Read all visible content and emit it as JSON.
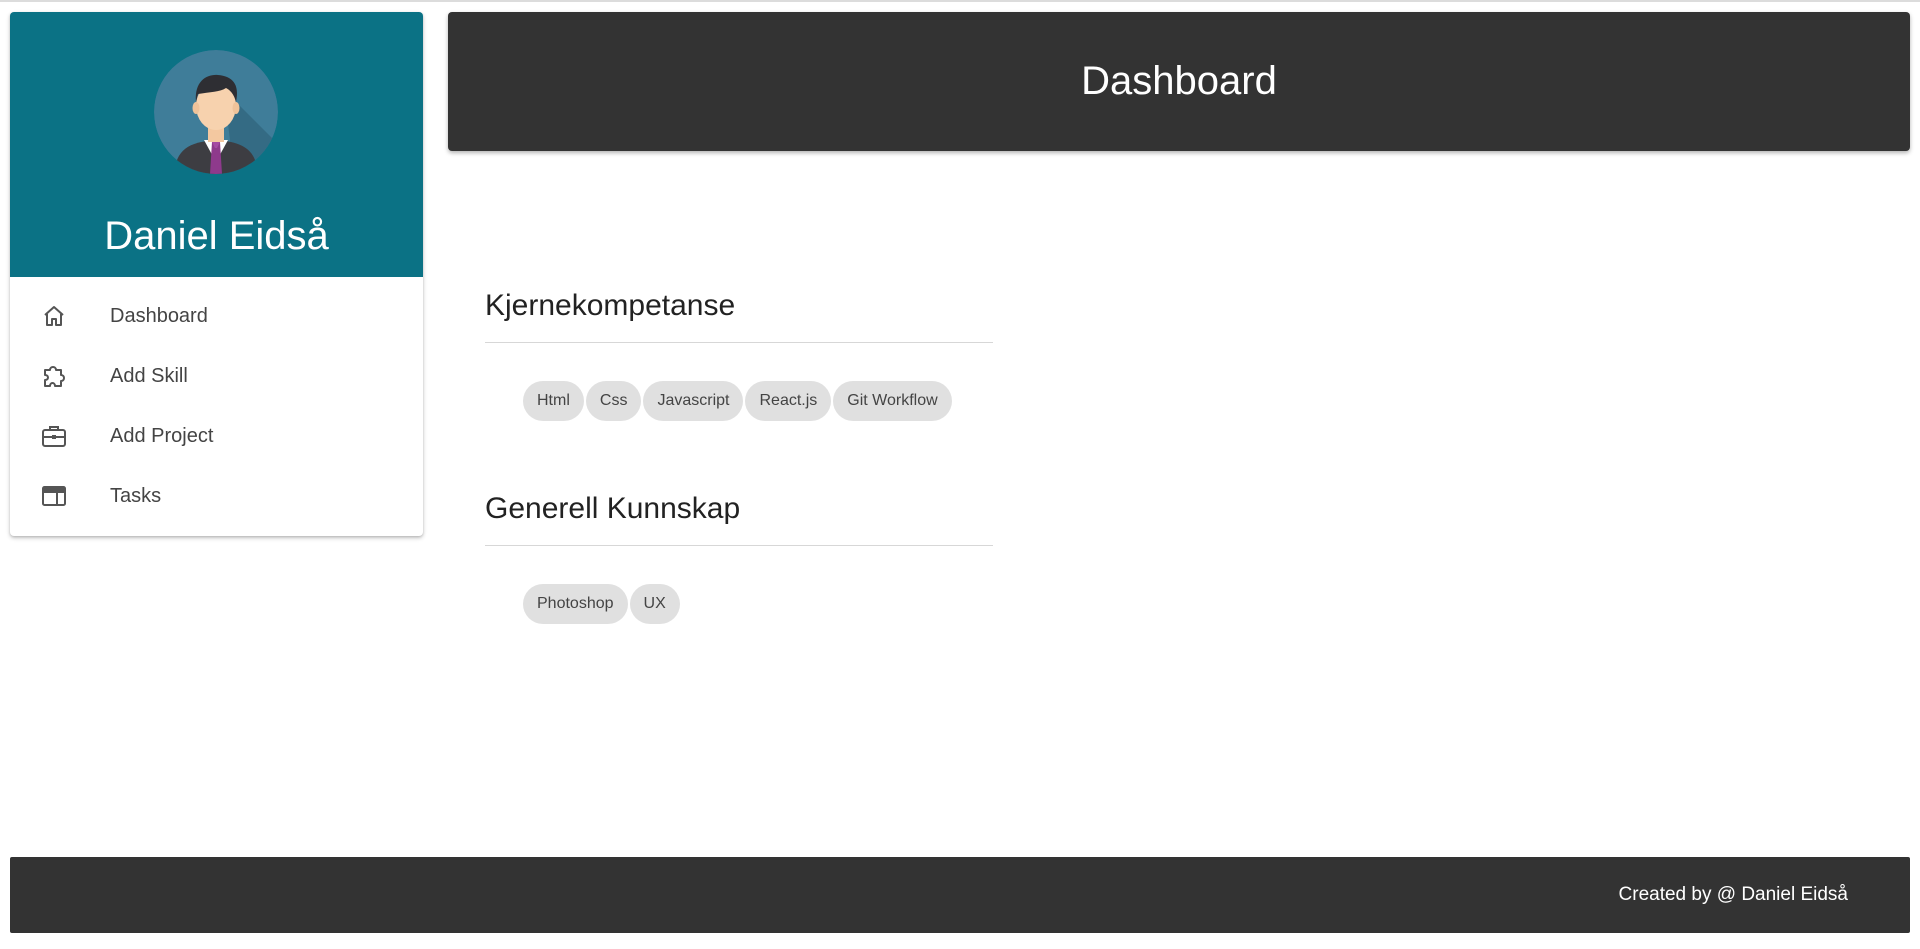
{
  "sidebar": {
    "profile": {
      "name": "Daniel Eidså",
      "avatar_icon": "businessman-avatar-icon"
    },
    "items": [
      {
        "label": "Dashboard",
        "icon": "home-icon"
      },
      {
        "label": "Add Skill",
        "icon": "puzzle-icon"
      },
      {
        "label": "Add Project",
        "icon": "briefcase-icon"
      },
      {
        "label": "Tasks",
        "icon": "web-layout-icon"
      }
    ]
  },
  "header": {
    "title": "Dashboard"
  },
  "sections": [
    {
      "title": "Kjernekompetanse",
      "chips": [
        "Html",
        "Css",
        "Javascript",
        "React.js",
        "Git Workflow"
      ]
    },
    {
      "title": "Generell Kunnskap",
      "chips": [
        "Photoshop",
        "UX"
      ]
    }
  ],
  "footer": {
    "text": "Created by @ Daniel Eidså"
  },
  "colors": {
    "profile_bg": "#0b7285",
    "header_bg": "#333333",
    "footer_bg": "#333333",
    "chip_bg": "#e0e0e0"
  }
}
